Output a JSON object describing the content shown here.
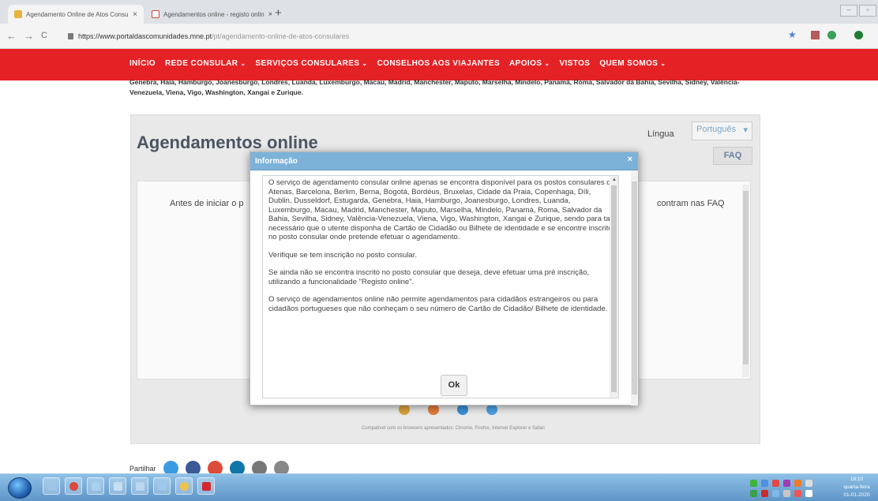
{
  "browser": {
    "tabs": [
      {
        "title": "Agendamento Online de Atos Consu",
        "close": "×",
        "icon": "portal-favicon"
      },
      {
        "title": "Agendamentos online - registo onlin",
        "close": "×",
        "icon": "gmail-favicon"
      }
    ],
    "new_tab": "+",
    "nav": {
      "back": "←",
      "forward": "→",
      "reload": "C"
    },
    "url_host": "https://www.portaldascomunidades.mne.pt",
    "url_path": "/pt/agendamento-online-de-atos-consulares",
    "bookmark_star": "★"
  },
  "site_nav": {
    "items": [
      {
        "label": "INÍCIO",
        "caret": ""
      },
      {
        "label": "REDE CONSULAR",
        "caret": "⌄"
      },
      {
        "label": "SERVIÇOS CONSULARES",
        "caret": "⌄"
      },
      {
        "label": "CONSELHOS AOS VIAJANTES",
        "caret": ""
      },
      {
        "label": "APOIOS",
        "caret": "⌄"
      },
      {
        "label": "VISTOS",
        "caret": ""
      },
      {
        "label": "QUEM SOMOS",
        "caret": "⌄"
      }
    ]
  },
  "intro_text": "Genebra, Haia, Hamburgo, Joanesburgo, Londres, Luanda, Luxemburgo, Macau, Madrid, Manchester, Maputo, Marselha, Mindelo, Panamá, Roma, Salvador da Bahia, Sevilha, Sidney, Valência-Venezuela, Viena, Vigo, Washington, Xangai e Zurique.",
  "panel": {
    "title": "Agendamentos online",
    "language_label": "Língua",
    "language_value": "Português",
    "language_caret": "▾",
    "faq_label": "FAQ",
    "inner_left_text": "Antes de iniciar o p",
    "inner_right_text": "contram nas FAQ",
    "browsers_note": "Compatível com os browsers apresentados: Chrome, Firefox, Internet Explorer e Safari"
  },
  "share": {
    "label": "Partilhar"
  },
  "modal": {
    "title": "Informação",
    "close": "×",
    "paragraphs": [
      "O serviço de agendamento consular online apenas se encontra disponível para os postos consulares de Atenas, Barcelona, Berlim, Berna, Bogotá, Bordéus, Bruxelas, Cidade da Praia, Copenhaga, Díli, Dublin, Dusseldorf, Estugarda, Genebra, Haia, Hamburgo, Joanesburgo, Londres, Luanda, Luxemburgo, Macau, Madrid, Manchester, Maputo, Marselha, Mindelo, Panamá, Roma, Salvador da Bahia, Sevilha, Sidney, Valência-Venezuela, Viena, Vigo, Washington, Xangai e Zurique, sendo para tal necessário que o utente disponha de Cartão de Cidadão ou Bilhete de identidade e se encontre inscrito no posto consular onde pretende efetuar o agendamento.",
      "Verifique se tem inscrição no posto consular.",
      "Se ainda não se encontra inscrito no posto consular que deseja, deve efetuar uma pré inscrição, utilizando a funcionalidade \"Registo online\".",
      "O serviço de agendamentos online não permite agendamentos para cidadãos estrangeiros ou para cidadãos portugueses que não conheçam o seu número de Cartão de Cidadão/ Bilhete de identidade."
    ],
    "ok_label": "Ok",
    "scroll_up": "▲"
  },
  "taskbar": {
    "clock_time": "18:10",
    "clock_day": "quarta-feira",
    "clock_date": "01-01-2020"
  },
  "colors": {
    "nav_red": "#e42226",
    "modal_header": "#7cb2d8",
    "taskbar": "#6fa4d3"
  }
}
